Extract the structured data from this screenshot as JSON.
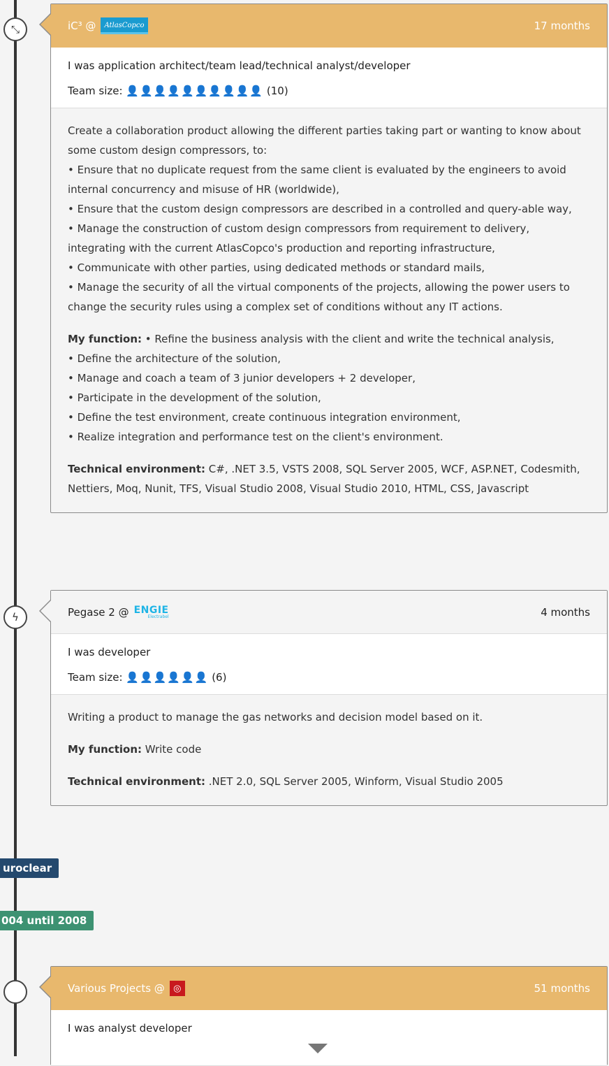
{
  "entries": [
    {
      "project": "iC³ @",
      "company_logo": "AtlasCopco",
      "duration": "17 months",
      "role": "I was application architect/team lead/technical analyst/developer",
      "team_label": "Team size:",
      "team_count": "(10)",
      "team_icons": "👤👤👤👤👤👤👤👤👤👤",
      "node_icon": "collapse-arrows-icon",
      "description": [
        "Create a collaboration product allowing the different parties taking part or wanting to know about some custom design compressors, to:",
        "• Ensure that no duplicate request from the same client is evaluated by the engineers to avoid internal concurrency and misuse of HR (worldwide),",
        "• Ensure that the custom design compressors are described in a controlled and query-able way,",
        "• Manage the construction of custom design compressors from requirement to delivery, integrating with the current AtlasCopco's production and reporting infrastructure,",
        "• Communicate with other parties, using dedicated methods or standard mails,",
        "• Manage the security of all the virtual components of the projects, allowing the power users to change the security rules using a complex set of conditions without any IT actions."
      ],
      "function_label": "My function:",
      "function_lines": [
        "• Refine the business analysis with the client and write the technical analysis,",
        "• Define the architecture of the solution,",
        "• Manage and coach a team of 3 junior developers + 2 developer,",
        "• Participate in the development of the solution,",
        "• Define the test environment, create continuous integration environment,",
        "• Realize integration and performance test on the client's environment."
      ],
      "tech_label": "Technical environment:",
      "tech_text": "C#, .NET 3.5, VSTS 2008, SQL Server 2005, WCF, ASP.NET, Codesmith, Nettiers, Moq, Nunit, TFS, Visual Studio 2008, Visual Studio 2010, HTML, CSS, Javascript"
    },
    {
      "project": "Pegase 2 @",
      "company_logo": "ENGIE",
      "company_logo_sub": "Electrabel",
      "duration": "4 months",
      "role": "I was developer",
      "team_label": "Team size:",
      "team_count": "(6)",
      "team_icons": "👤👤👤👤👤👤",
      "node_icon": "lightning-icon",
      "description": "Writing a product to manage the gas networks and decision model based on it.",
      "function_label": "My function:",
      "function_text": "Write code",
      "tech_label": "Technical environment:",
      "tech_text": ".NET 2.0, SQL Server 2005, Winform, Visual Studio 2005"
    },
    {
      "project": "Various Projects @",
      "company_logo": "◎",
      "duration": "51 months",
      "role": "I was analyst developer",
      "node_icon": "empty-circle-icon"
    }
  ],
  "company_badge": "uroclear",
  "date_badge": "004 until 2008",
  "colors": {
    "header_gold": "#e8b86d",
    "company_badge": "#24496e",
    "date_badge": "#3d9272",
    "team_icon": "#2f6e8e"
  }
}
